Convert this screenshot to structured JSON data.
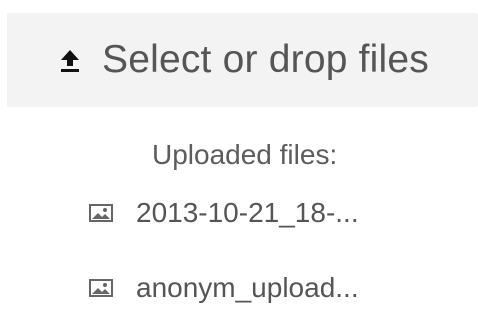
{
  "upload": {
    "icon": "upload-icon",
    "label": "Select or drop files"
  },
  "uploaded": {
    "title": "Uploaded files:",
    "files": [
      {
        "icon": "image-icon",
        "name": "2013-10-21_18-..."
      },
      {
        "icon": "image-icon",
        "name": "anonym_upload..."
      }
    ]
  }
}
